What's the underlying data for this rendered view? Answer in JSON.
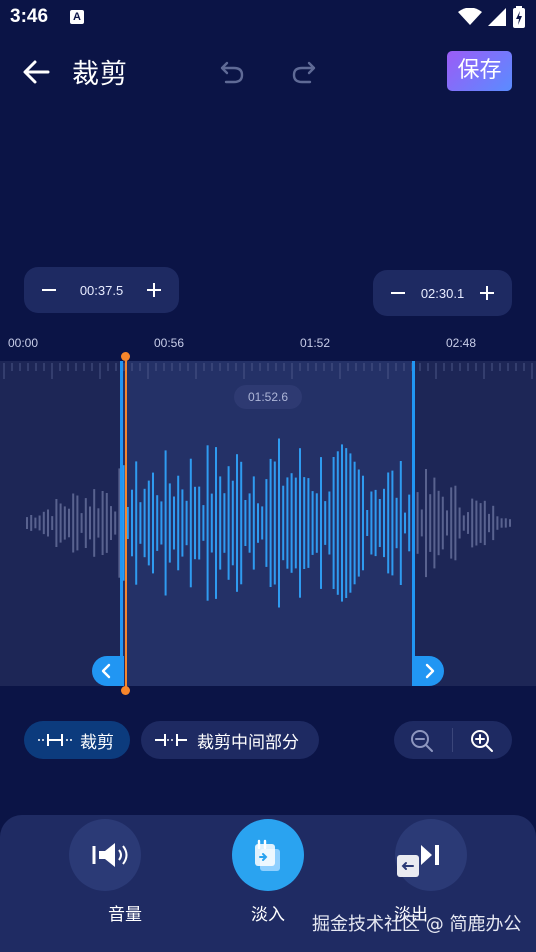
{
  "status": {
    "time": "3:46",
    "badge": "A"
  },
  "header": {
    "title": "裁剪",
    "save_label": "保存"
  },
  "trim": {
    "start_value": "00:37.5",
    "end_value": "02:30.1",
    "playhead_value": "01:52.6"
  },
  "ruler": {
    "labels": [
      "00:00",
      "00:56",
      "01:52",
      "02:48"
    ]
  },
  "modes": {
    "trim_label": "裁剪",
    "trim_middle_label": "裁剪中间部分"
  },
  "tools": [
    {
      "label": "音量",
      "icon": "volume-icon"
    },
    {
      "label": "淡入",
      "icon": "fade-in-icon"
    },
    {
      "label": "淡出",
      "icon": "fade-out-icon"
    }
  ],
  "watermark": "掘金技术社区 @ 简鹿办公",
  "colors": {
    "background": "#0b1446",
    "accent": "#2196f3",
    "playhead": "#f7862b",
    "save": "#9b5cf6"
  }
}
